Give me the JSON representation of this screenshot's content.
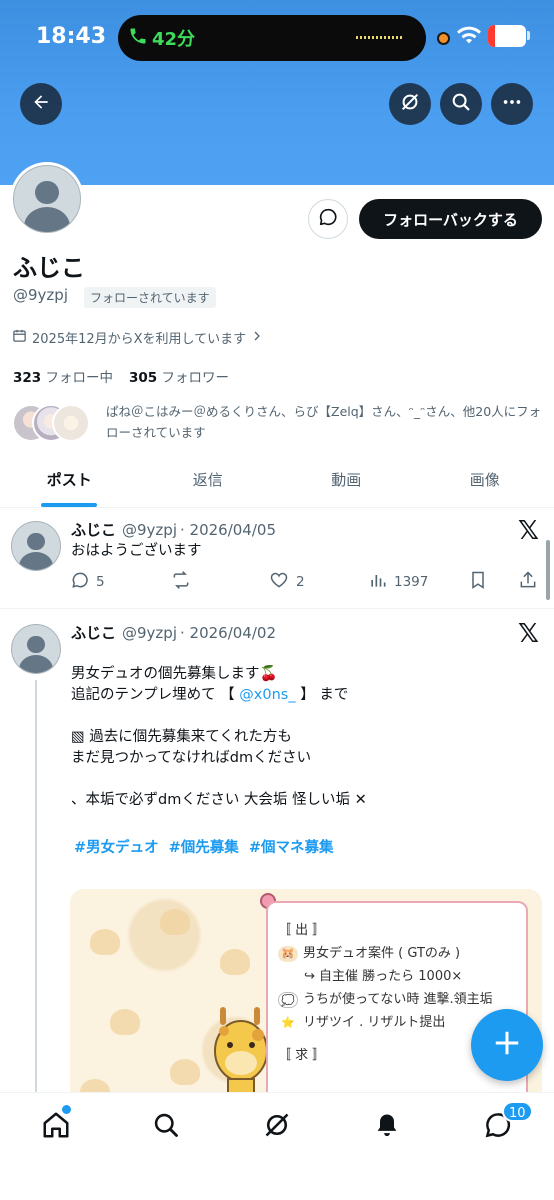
{
  "status_bar": {
    "time": "18:43",
    "call_duration": "42分",
    "battery_level": "18",
    "battery_percent": 0.18
  },
  "header": {
    "back_icon": "arrow-left-icon",
    "actions": [
      "grok-icon",
      "search-icon",
      "more-icon"
    ]
  },
  "profile": {
    "display_name": "ふじこ",
    "handle": "@9yzpj",
    "follows_you_badge": "フォローされています",
    "joined": "2025年12月からXを利用しています",
    "following_count": "323",
    "following_label": "フォロー中",
    "followers_count": "305",
    "followers_label": "フォロワー",
    "followed_by": "ぱね＠こはみー＠めるくりさん、らび【Zelq】さん、ᵔ_ᵔさん、他20人にフォローされています",
    "follow_back_button": "フォローバックする"
  },
  "tabs": [
    {
      "label": "ポスト",
      "active": true
    },
    {
      "label": "返信",
      "active": false
    },
    {
      "label": "動画",
      "active": false
    },
    {
      "label": "画像",
      "active": false
    }
  ],
  "posts": [
    {
      "name": "ふじこ",
      "handle": "@9yzpj",
      "date": "· 2026/04/05",
      "text": "おはようございます",
      "replies": "5",
      "likes": "2",
      "views": "1397"
    },
    {
      "name": "ふじこ",
      "handle": "@9yzpj",
      "date": "· 2026/04/02",
      "line1": "男女デュオの個先募集します🍒",
      "line2_pre": "追記のテンプレ埋めて 【 ",
      "line2_mention": "@x0ns_",
      "line2_post": " 】 まで",
      "line3": "▧ 過去に個先募集来てくれた方も",
      "line4": "まだ見つかってなければdmください",
      "line5": "、本垢で必ずdmください 大会垢 怪しい垢 ✕",
      "hashtags": [
        "#男女デュオ",
        "#個先募集",
        "#個マネ募集"
      ],
      "image_note": {
        "section1": "〚 出 〛",
        "item1": "男女デュオ案件 ( GTのみ )",
        "item1_sub": "↪ 自主催 勝ったら 1000×",
        "item2": "うちが使ってない時 進撃.領主垢",
        "item3": "リザツイ . リザルト提出",
        "section2": "〚 求 〛"
      }
    }
  ],
  "bottom_nav": {
    "items": [
      "home-icon",
      "search-icon",
      "grok-icon",
      "notifications-icon",
      "messages-icon"
    ],
    "messages_badge": "10"
  },
  "colors": {
    "accent": "#1d9bf0",
    "banner": "#4b9df0",
    "text": "#0f1419",
    "muted": "#536471"
  }
}
